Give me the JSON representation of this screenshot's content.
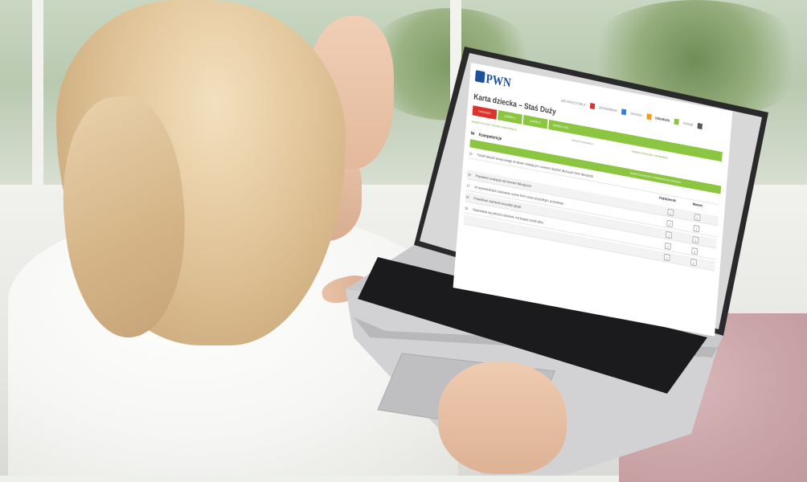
{
  "scene": {
    "description_tags": [
      "woman-back-view",
      "blonde-ponytail",
      "white-tshirt",
      "laptop",
      "sofa"
    ]
  },
  "screen": {
    "logo": "PWN",
    "top_links": "",
    "nav": [
      {
        "label": "BIO NAUCZYCIELA",
        "color": "#d9342b"
      },
      {
        "label": "ZAGADNIENIA",
        "color": "#3a7fcf"
      },
      {
        "label": "ZADANIA",
        "color": "#f29a1f"
      },
      {
        "label": "DIAGNOZA",
        "color": "#8cc640"
      },
      {
        "label": "FORUM",
        "color": "#555555"
      }
    ],
    "title": "Karta dziecka – Staś Duży",
    "tabs": [
      {
        "label": "DIAGNOZA",
        "color": "#d9342b"
      },
      {
        "label": "ZAKRES 1",
        "color": "#8cc640"
      },
      {
        "label": "ZAKRES 2",
        "color": "#8cc640"
      },
      {
        "label": "ZAKRES 3 ITD.",
        "color": "#8cc640"
      }
    ],
    "subtabs": [
      "ROZWÓJ FIZYCZNY I ROZWÓJ EMOCJONALNY",
      "ROZWÓJ POZNAWCZY",
      "ROZWÓJ SPOŁECZNY I SPRAWNOŚĆ"
    ],
    "table": {
      "col_nr": "Nr",
      "col_comp": "Kompetencje",
      "col_oct": "Październik",
      "col_mar": "Marzec",
      "green_bar": "ROZWÓJ SPOŁECZNY I SPRAWNOŚĆ MOTORYCZNA",
      "rows": [
        {
          "nr": "15",
          "text": "Potrafi okazać swoją uwagę na słowie mówiącym i uważnie słuchać dłuższych form literackich.",
          "oct": "3",
          "mar": "3"
        },
        {
          "nr": "16",
          "text": "Poprawnie posługuje się formami fleksyjnymi.",
          "oct": "2",
          "mar": "3"
        },
        {
          "nr": "17",
          "text": "W wypowiedziach poprawnie używa form czasu przyszłego i przeszłego.",
          "oct": "2",
          "mar": "3"
        },
        {
          "nr": "18",
          "text": "Prawidłowo wymawia wszystkie głoski.",
          "oct": "2",
          "mar": "3"
        },
        {
          "nr": "19",
          "text": "Wypowiada się pełnymi zdaniami, ma bogaty zasób słów.",
          "oct": "2",
          "mar": "3"
        }
      ]
    }
  }
}
